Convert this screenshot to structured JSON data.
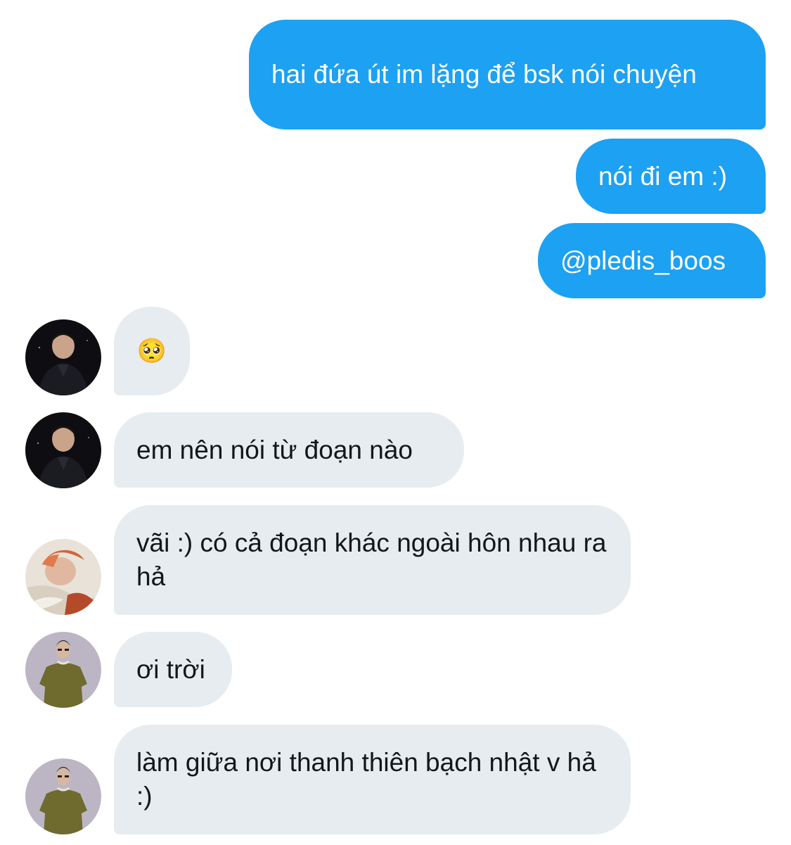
{
  "conversation": {
    "sent": [
      {
        "text": "hai đứa út im lặng để bsk nói chuyện"
      },
      {
        "text": "nói đi em :)"
      },
      {
        "text": "@pledis_boos"
      }
    ],
    "received": [
      {
        "text": "🥺",
        "avatar": "avatar-dark-suit"
      },
      {
        "text": "em nên nói từ đoạn nào",
        "avatar": "avatar-dark-suit"
      },
      {
        "text": "vãi :) có cả đoạn khác ngoài hôn nhau ra hả",
        "avatar": "avatar-red-hair"
      },
      {
        "text": "ơi trời",
        "avatar": "avatar-olive-shirt"
      },
      {
        "text": "làm giữa nơi thanh thiên bạch nhật v hả :)",
        "avatar": "avatar-olive-shirt"
      }
    ]
  },
  "colors": {
    "sent_bubble": "#1da1f2",
    "received_bubble": "#e6ecf0"
  }
}
